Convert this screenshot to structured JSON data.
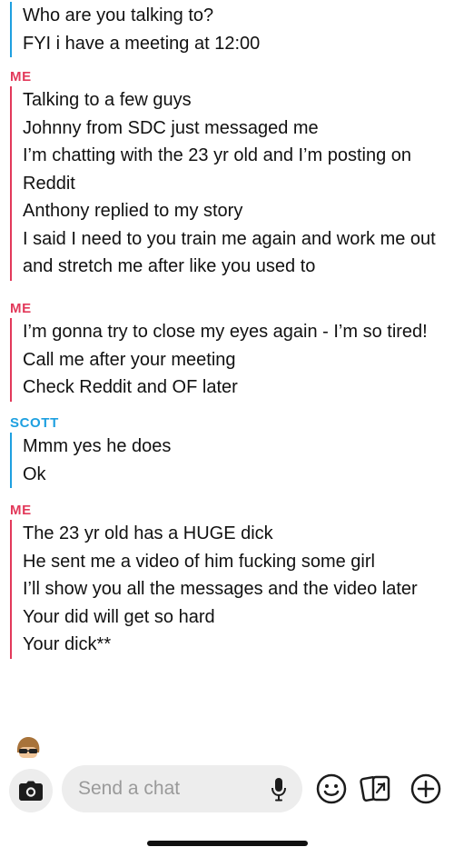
{
  "chat": {
    "first": {
      "messages": [
        "Who are you talking to?",
        "FYI i have a meeting at 12:00"
      ]
    },
    "groups": [
      {
        "sender": "ME",
        "messages": [
          "Talking to a few guys",
          "Johnny from SDC just messaged me",
          "I’m chatting with the 23 yr old and I’m posting on Reddit",
          "Anthony replied to my story",
          "I said I need to you train me again and work me out and stretch me after like you used to"
        ]
      },
      {
        "sender": "ME",
        "messages": [
          "I’m gonna try to close my eyes again - I’m so tired! Call me after your meeting",
          "Check Reddit and OF later"
        ]
      },
      {
        "sender": "SCOTT",
        "messages": [
          "Mmm yes he does",
          "Ok"
        ]
      },
      {
        "sender": "ME",
        "messages": [
          "The 23 yr old has a HUGE dick",
          "He sent me a video of him fucking some girl",
          "I’ll show you all the messages and the video later",
          "Your did will get so hard",
          "Your dick**"
        ]
      }
    ]
  },
  "composer": {
    "placeholder": "Send a chat",
    "camera_icon": "camera-icon",
    "mic_icon": "microphone-icon",
    "emoji_icon": "smiley-icon",
    "cards_icon": "cards-icon",
    "plus_icon": "plus-icon"
  },
  "colors": {
    "me": "#e2395a",
    "scott": "#1ea0e0",
    "input_bg": "#ededed",
    "placeholder": "#9a9a9a"
  }
}
